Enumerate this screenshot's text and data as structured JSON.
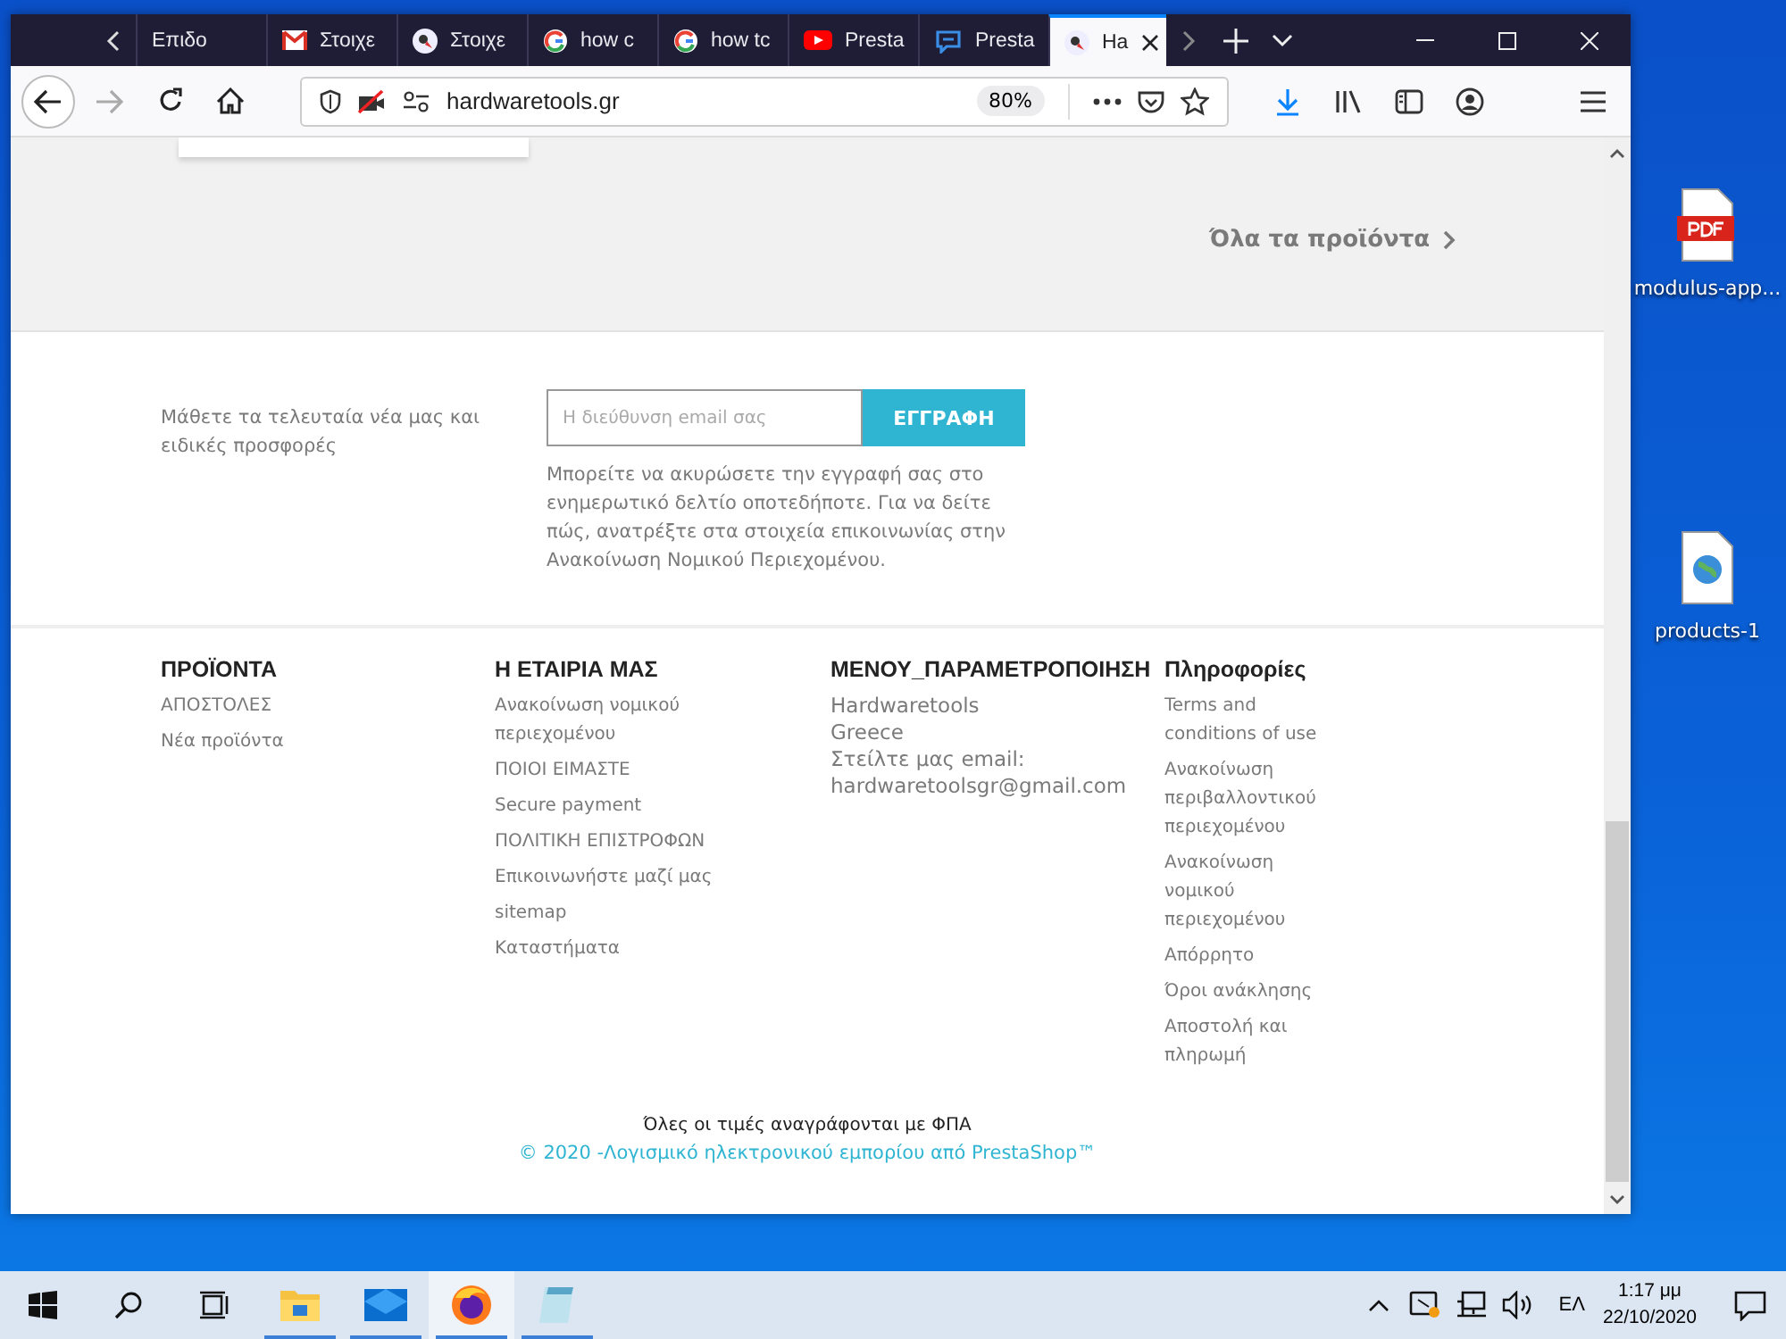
{
  "browser": {
    "tabs": [
      {
        "label": "Επιδο",
        "selected": false
      },
      {
        "label": "Στοιχε",
        "selected": false
      },
      {
        "label": "Στοιχε",
        "selected": false
      },
      {
        "label": "how c",
        "selected": false
      },
      {
        "label": "how tc",
        "selected": false
      },
      {
        "label": "Presta",
        "selected": false
      },
      {
        "label": "Presta",
        "selected": false
      },
      {
        "label": "Ha",
        "selected": true
      }
    ],
    "url": "hardwaretools.gr",
    "zoom": "80%"
  },
  "page": {
    "all_products_link": "Όλα τα προϊόντα",
    "newsletter": {
      "text": "Μάθετε τα τελευταία νέα μας και ειδικές προσφορές",
      "placeholder": "Η διεύθυνση email σας",
      "button": "ΕΓΓΡΑΦΗ",
      "note": "Μπορείτε να ακυρώσετε την εγγραφή σας στο ενημερωτικό δελτίο οποτεδήποτε. Για να δείτε πώς, ανατρέξτε στα στοιχεία επικοινωνίας στην Ανακοίνωση Νομικού Περιεχομένου."
    },
    "footer_columns": [
      {
        "title": "ΠΡΟΪΟΝΤΑ",
        "kind": "links",
        "items": [
          "ΑΠΟΣΤΟΛΕΣ",
          "Νέα προϊόντα"
        ]
      },
      {
        "title": "Η ΕΤΑΙΡΙΑ ΜΑΣ",
        "kind": "links",
        "items": [
          "Ανακοίνωση νομικού περιεχομένου",
          "ΠΟΙΟΙ ΕΙΜΑΣΤΕ",
          "Secure payment",
          "ΠΟΛΙΤΙΚΗ ΕΠΙΣΤΡΟΦΩΝ",
          "Επικοινωνήστε μαζί μας",
          "sitemap",
          "Καταστήματα"
        ]
      },
      {
        "title": "ΜΕΝΟΥ_ΠΑΡΑΜΕΤΡΟΠΟΙΗΣΗ",
        "kind": "text",
        "items": [
          "Hardwaretools",
          "Greece",
          "Στείλτε μας email:",
          "hardwaretoolsgr@gmail.com"
        ]
      },
      {
        "title": "Πληροφορίες",
        "kind": "links",
        "items": [
          "Terms and conditions of use",
          "Ανακοίνωση περιβαλλοντικού περιεχομένου",
          "Ανακοίνωση νομικού περιεχομένου",
          "Απόρρητο",
          "Όροι ανάκλησης",
          "Αποστολή και πληρωμή"
        ]
      }
    ],
    "prices_note": "Όλες οι τιμές αναγράφονται με ΦΠΑ",
    "copyright": "© 2020 -Λογισμικό ηλεκτρονικού εμπορίου από PrestaShop™"
  },
  "desktop_icons": [
    {
      "label": "modulus-app...",
      "kind": "pdf"
    },
    {
      "label": "products-1",
      "kind": "web"
    }
  ],
  "taskbar": {
    "apps": [
      {
        "kind": "folder",
        "selected": false
      },
      {
        "kind": "mail",
        "selected": false
      },
      {
        "kind": "browser",
        "selected": true
      },
      {
        "kind": "notepad",
        "selected": false
      }
    ],
    "language": "ΕΛ",
    "time": "1:17 μμ",
    "date": "22/10/2020"
  }
}
